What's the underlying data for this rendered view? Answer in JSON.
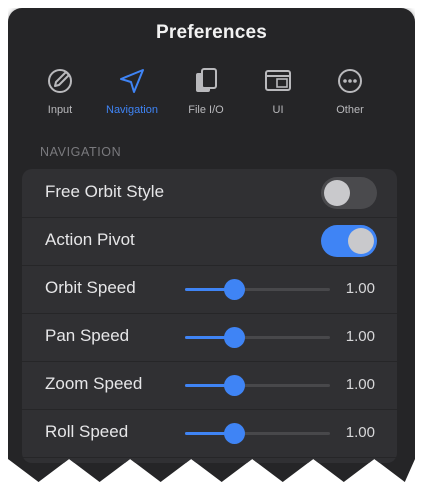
{
  "window": {
    "title": "Preferences"
  },
  "tabs": [
    {
      "label": "Input",
      "icon": "pencil-circle-icon",
      "active": false
    },
    {
      "label": "Navigation",
      "icon": "navigation-arrow-icon",
      "active": true
    },
    {
      "label": "File I/O",
      "icon": "files-icon",
      "active": false
    },
    {
      "label": "UI",
      "icon": "window-layout-icon",
      "active": false
    },
    {
      "label": "Other",
      "icon": "ellipsis-circle-icon",
      "active": false
    }
  ],
  "section": {
    "header": "NAVIGATION"
  },
  "rows": [
    {
      "label": "Free Orbit Style",
      "type": "toggle",
      "on": false
    },
    {
      "label": "Action Pivot",
      "type": "toggle",
      "on": true
    },
    {
      "label": "Orbit Speed",
      "type": "slider",
      "value": "1.00",
      "level": 0.34
    },
    {
      "label": "Pan Speed",
      "type": "slider",
      "value": "1.00",
      "level": 0.34
    },
    {
      "label": "Zoom Speed",
      "type": "slider",
      "value": "1.00",
      "level": 0.34
    },
    {
      "label": "Roll Speed",
      "type": "slider",
      "value": "1.00",
      "level": 0.34
    }
  ],
  "colors": {
    "accent": "#3f84f5",
    "panel": "#252527",
    "list": "#303033"
  }
}
